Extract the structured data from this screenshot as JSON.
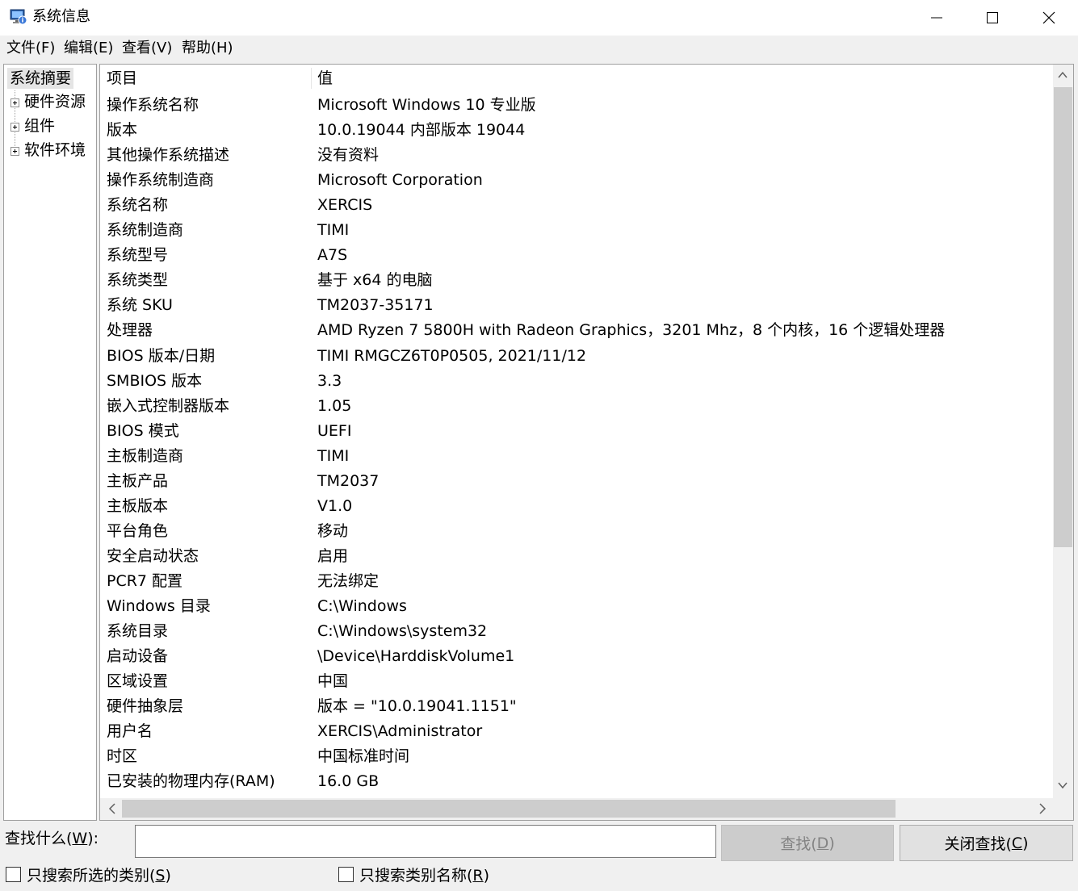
{
  "window": {
    "title": "系统信息",
    "icon": "system-info-icon"
  },
  "menu": [
    {
      "label": "文件(F)"
    },
    {
      "label": "编辑(E)"
    },
    {
      "label": "查看(V)"
    },
    {
      "label": "帮助(H)"
    }
  ],
  "tree": {
    "root": "系统摘要",
    "children": [
      {
        "label": "硬件资源"
      },
      {
        "label": "组件"
      },
      {
        "label": "软件环境"
      }
    ]
  },
  "list": {
    "headers": {
      "item": "项目",
      "value": "值"
    },
    "rows": [
      {
        "item": "操作系统名称",
        "value": "Microsoft Windows 10 专业版"
      },
      {
        "item": "版本",
        "value": "10.0.19044 内部版本 19044"
      },
      {
        "item": "其他操作系统描述",
        "value": "没有资料"
      },
      {
        "item": "操作系统制造商",
        "value": "Microsoft Corporation"
      },
      {
        "item": "系统名称",
        "value": "XERCIS"
      },
      {
        "item": "系统制造商",
        "value": "TIMI"
      },
      {
        "item": "系统型号",
        "value": "A7S"
      },
      {
        "item": "系统类型",
        "value": "基于 x64 的电脑"
      },
      {
        "item": "系统 SKU",
        "value": "TM2037-35171"
      },
      {
        "item": "处理器",
        "value": "AMD Ryzen 7 5800H with Radeon Graphics，3201 Mhz，8 个内核，16 个逻辑处理器"
      },
      {
        "item": "BIOS 版本/日期",
        "value": "TIMI RMGCZ6T0P0505, 2021/11/12"
      },
      {
        "item": "SMBIOS 版本",
        "value": "3.3"
      },
      {
        "item": "嵌入式控制器版本",
        "value": "1.05"
      },
      {
        "item": "BIOS 模式",
        "value": "UEFI"
      },
      {
        "item": "主板制造商",
        "value": "TIMI"
      },
      {
        "item": "主板产品",
        "value": "TM2037"
      },
      {
        "item": "主板版本",
        "value": "V1.0"
      },
      {
        "item": "平台角色",
        "value": "移动"
      },
      {
        "item": "安全启动状态",
        "value": "启用"
      },
      {
        "item": "PCR7 配置",
        "value": "无法绑定"
      },
      {
        "item": "Windows 目录",
        "value": "C:\\Windows"
      },
      {
        "item": "系统目录",
        "value": "C:\\Windows\\system32"
      },
      {
        "item": "启动设备",
        "value": "\\Device\\HarddiskVolume1"
      },
      {
        "item": "区域设置",
        "value": "中国"
      },
      {
        "item": "硬件抽象层",
        "value": "版本 = \"10.0.19041.1151\""
      },
      {
        "item": "用户名",
        "value": "XERCIS\\Administrator"
      },
      {
        "item": "时区",
        "value": "中国标准时间"
      },
      {
        "item": "已安装的物理内存(RAM)",
        "value": "16.0 GB"
      }
    ]
  },
  "find": {
    "label_pre": "查找什么(",
    "label_key": "W",
    "label_post": "):",
    "input_value": "",
    "find_pre": "查找(",
    "find_key": "D",
    "find_post": ")",
    "close_pre": "关闭查找(",
    "close_key": "C",
    "close_post": ")",
    "option1_pre": "只搜索所选的类别(",
    "option1_key": "S",
    "option1_post": ")",
    "option2_pre": "只搜索类别名称(",
    "option2_key": "R",
    "option2_post": ")"
  }
}
